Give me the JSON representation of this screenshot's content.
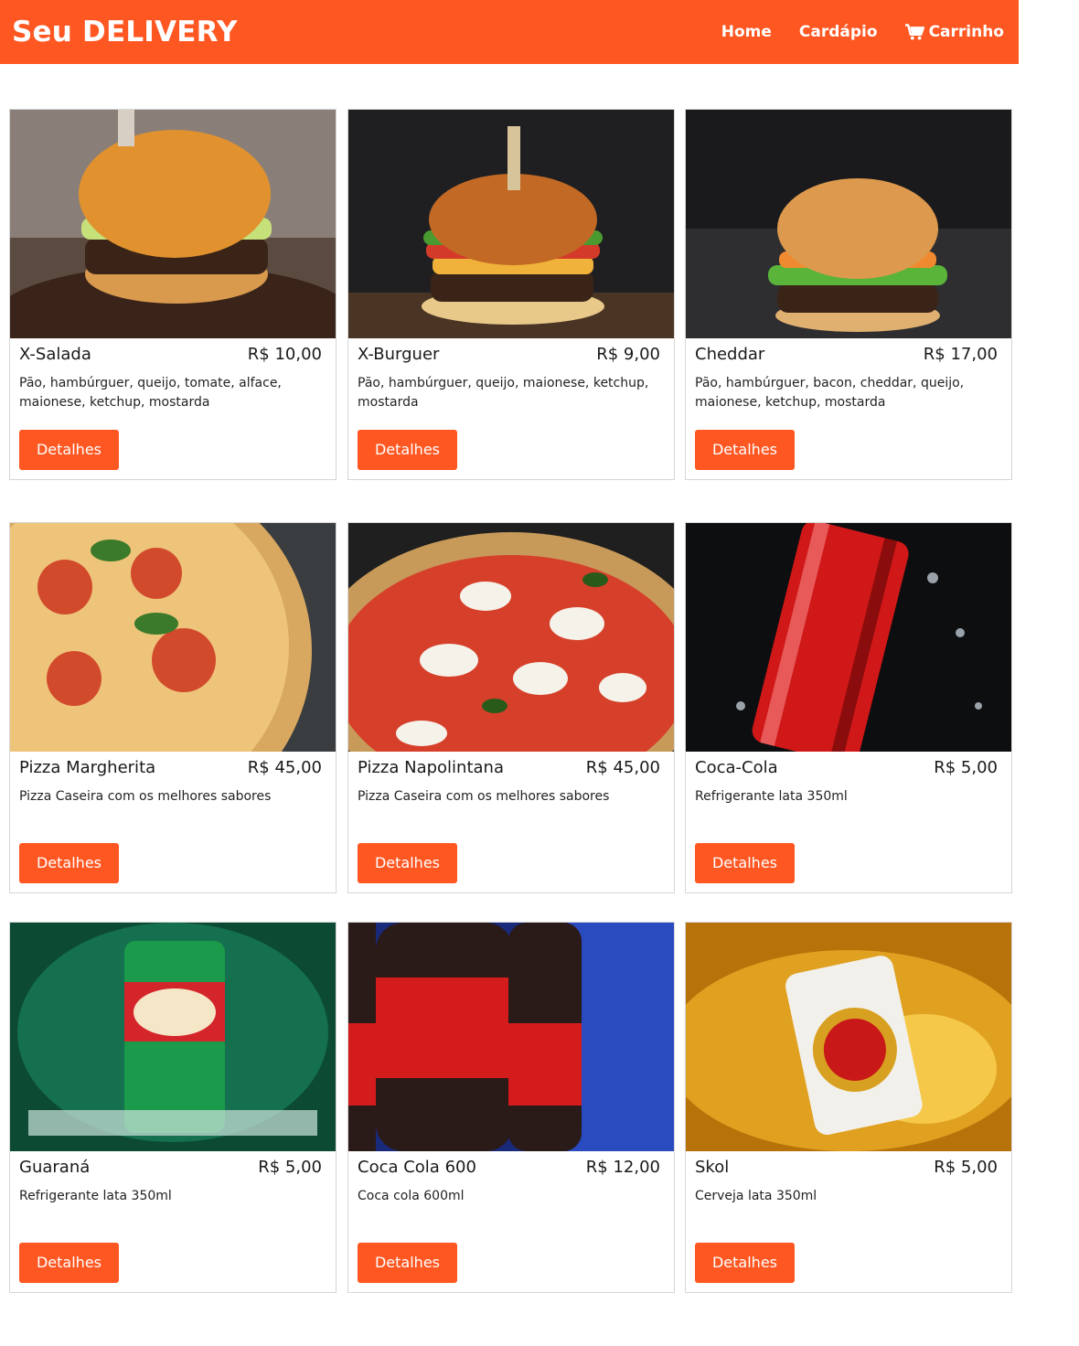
{
  "navbar": {
    "brand": "Seu DELIVERY",
    "links": [
      "Home",
      "Cardápio",
      "Carrinho"
    ]
  },
  "products": [
    {
      "name": "X-Salada",
      "price": "R$ 10,00",
      "desc": "Pão, hambúrguer, queijo, tomate, alface, maionese, ketchup, mostarda",
      "button": "Detalhes",
      "image": "burger-photo"
    },
    {
      "name": "X-Burguer",
      "price": "R$ 9,00",
      "desc": "Pão, hambúrguer, queijo, maionese, ketchup, mostarda",
      "button": "Detalhes",
      "image": "burger-photo"
    },
    {
      "name": "Cheddar",
      "price": "R$ 17,00",
      "desc": "Pão, hambúrguer, bacon, cheddar, queijo, maionese, ketchup, mostarda",
      "button": "Detalhes",
      "image": "burger-photo"
    },
    {
      "name": "Pizza Margherita",
      "price": "R$ 45,00",
      "desc": "Pizza Caseira com os melhores sabores",
      "button": "Detalhes",
      "image": "pizza-photo"
    },
    {
      "name": "Pizza Napolintana",
      "price": "R$ 45,00",
      "desc": "Pizza Caseira com os melhores sabores",
      "button": "Detalhes",
      "image": "pizza-photo"
    },
    {
      "name": "Coca-Cola",
      "price": "R$ 5,00",
      "desc": "Refrigerante lata 350ml",
      "button": "Detalhes",
      "image": "can-photo"
    },
    {
      "name": "Guaraná",
      "price": "R$ 5,00",
      "desc": "Refrigerante lata 350ml",
      "button": "Detalhes",
      "image": "can-photo"
    },
    {
      "name": "Coca Cola 600",
      "price": "R$ 12,00",
      "desc": "Coca cola 600ml",
      "button": "Detalhes",
      "image": "bottle-photo"
    },
    {
      "name": "Skol",
      "price": "R$ 5,00",
      "desc": "Cerveja lata 350ml",
      "button": "Detalhes",
      "image": "can-photo"
    }
  ],
  "colors": {
    "accent": "#ff5722",
    "border": "#d6d6d6"
  },
  "icons": {
    "cart": "cart-icon"
  }
}
